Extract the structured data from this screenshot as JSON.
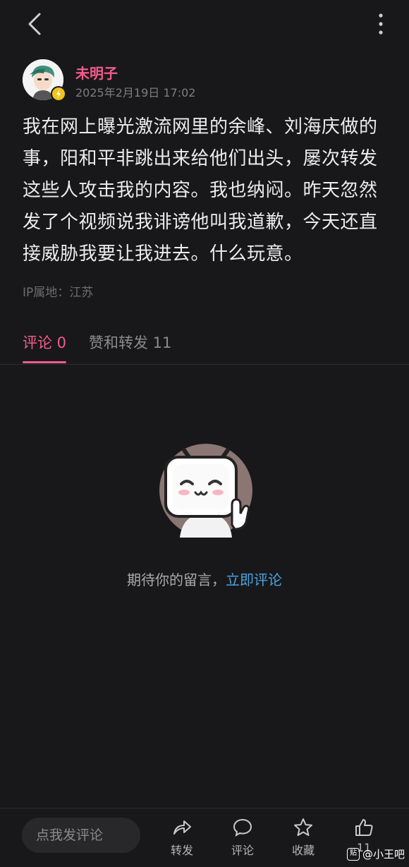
{
  "author": {
    "name": "未明子",
    "time": "2025年2月19日 17:02"
  },
  "post": {
    "text": "我在网上曝光激流网里的余峰、刘海庆做的事，阳和平非跳出来给他们出头，屡次转发这些人攻击我的内容。我也纳闷。昨天忽然发了个视频说我诽谤他叫我道歉，今天还直接威胁我要让我进去。什么玩意。",
    "ip_location": "IP属地：江苏"
  },
  "tabs": {
    "comments": "评论 0",
    "likes_reposts": "赞和转发 11"
  },
  "empty_state": {
    "message": "期待你的留言，",
    "link": "立即评论"
  },
  "bottom_bar": {
    "input_placeholder": "点我发评论",
    "repost": "转发",
    "comment": "评论",
    "favorite": "收藏",
    "like": "11"
  },
  "watermark": {
    "icon": "贴",
    "text": "@小王吧"
  },
  "colors": {
    "accent": "#f25c8d",
    "link": "#4aa3e0",
    "background": "#18181a"
  }
}
